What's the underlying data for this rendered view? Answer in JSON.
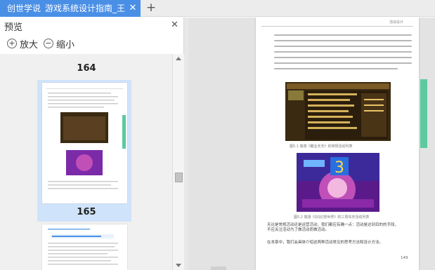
{
  "tabs": {
    "app_name": "创世学说",
    "active_tab_title": "游戏系统设计指南_王",
    "close_symbol": "✕",
    "new_tab_symbol": "+"
  },
  "sidebar": {
    "title": "预览",
    "close_symbol": "✕",
    "zoom_in_label": "放大",
    "zoom_out_label": "缩小",
    "zoom_in_symbol": "+",
    "zoom_out_symbol": "−",
    "page_numbers": [
      "164",
      "165"
    ]
  },
  "main": {
    "header_text": "活动设计",
    "figure1_caption": "图5.1 端游《霸业天天》的常规活动列表",
    "figure2_caption": "图5.2 端游《QQ幻想世界》的三周年庆活动列表",
    "page_number": "149",
    "paragraph_end_1": "无论是常规活动还是运营活动，我们都应有确一点：活动是达到目的的手段，",
    "paragraph_end_2": "不应关注活动为了做活动而做活动。",
    "paragraph_end_3": "在本章中，我们会具体介绍这两种活动常见的思考方法和设计方法。"
  },
  "icons": {
    "zoom_in": "zoom-in-icon",
    "zoom_out": "zoom-out-icon",
    "close": "close-icon",
    "add_tab": "plus-icon"
  },
  "colors": {
    "tab_blue": "#4a8fe6",
    "selection_blue": "#cfe3fa",
    "accent_green": "#5cc9a0",
    "game_purple": "#7b2aa8",
    "game_brown": "#3a2a12"
  }
}
